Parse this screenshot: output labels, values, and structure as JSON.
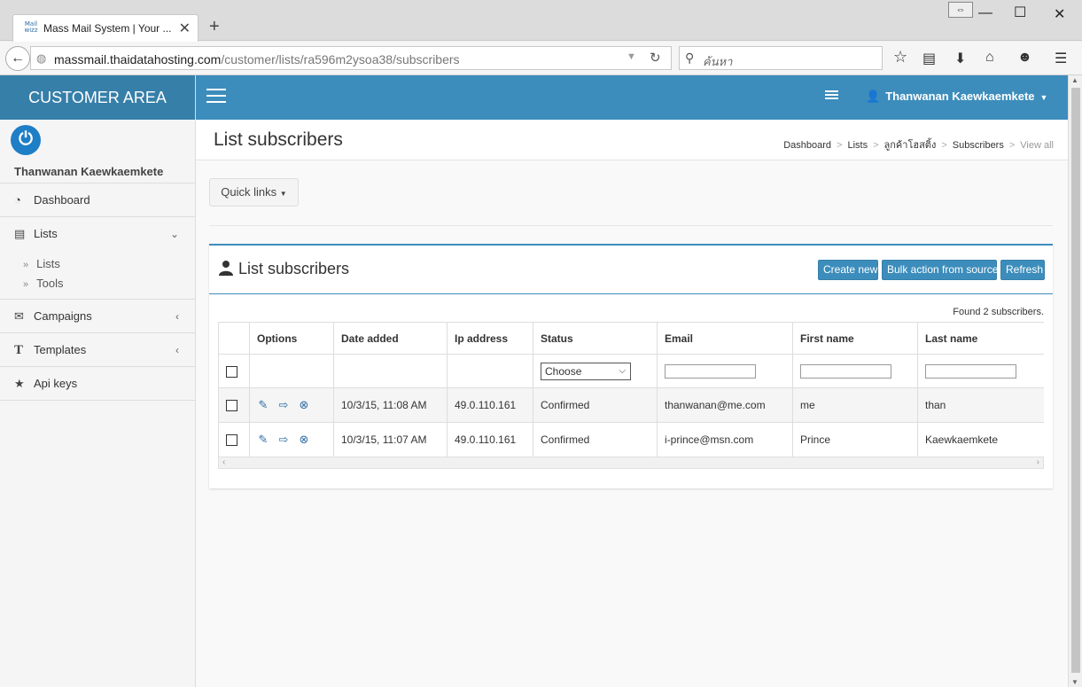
{
  "browser": {
    "tab_title": "Mass Mail System | Your ...",
    "tab_favicon": "Mail wizz",
    "url_host": "massmail.thaidatahosting.com",
    "url_path": "/customer/lists/ra596m2ysoa38/subscribers",
    "url_prefix": "",
    "search_placeholder": "ค้นหา"
  },
  "sidebar": {
    "brand": "CUSTOMER AREA",
    "user_name": "Thanwanan Kaewkaemkete",
    "items": [
      {
        "label": "Dashboard",
        "icon": "dashboard-icon"
      },
      {
        "label": "Lists",
        "icon": "list-icon"
      },
      {
        "label": "Campaigns",
        "icon": "envelope-icon"
      },
      {
        "label": "Templates",
        "icon": "text-icon"
      },
      {
        "label": "Api keys",
        "icon": "star-icon"
      }
    ],
    "lists_sub": [
      "Lists",
      "Tools"
    ]
  },
  "header": {
    "user_name": "Thanwanan Kaewkaemkete"
  },
  "page": {
    "title": "List subscribers",
    "breadcrumb": [
      "Dashboard",
      "Lists",
      "ลูกค้าโฮสติ้ง",
      "Subscribers",
      "View all"
    ],
    "quick_links": "Quick links"
  },
  "box": {
    "title": "List subscribers",
    "buttons": {
      "create_new": "Create new",
      "bulk_action": "Bulk action from source",
      "refresh": "Refresh"
    },
    "found": "Found 2 subscribers.",
    "columns": [
      "Options",
      "Date added",
      "Ip address",
      "Status",
      "Email",
      "First name",
      "Last name"
    ],
    "status_filter": "Choose",
    "rows": [
      {
        "date_added": "10/3/15, 11:08 AM",
        "ip": "49.0.110.161",
        "status": "Confirmed",
        "email": "thanwanan@me.com",
        "first_name": "me",
        "last_name": "than"
      },
      {
        "date_added": "10/3/15, 11:07 AM",
        "ip": "49.0.110.161",
        "status": "Confirmed",
        "email": "i-prince@msn.com",
        "first_name": "Prince",
        "last_name": "Kaewkaemkete"
      }
    ]
  },
  "colors": {
    "brand": "#367fa9",
    "header": "#3c8dbc",
    "button": "#3c8dbc"
  }
}
